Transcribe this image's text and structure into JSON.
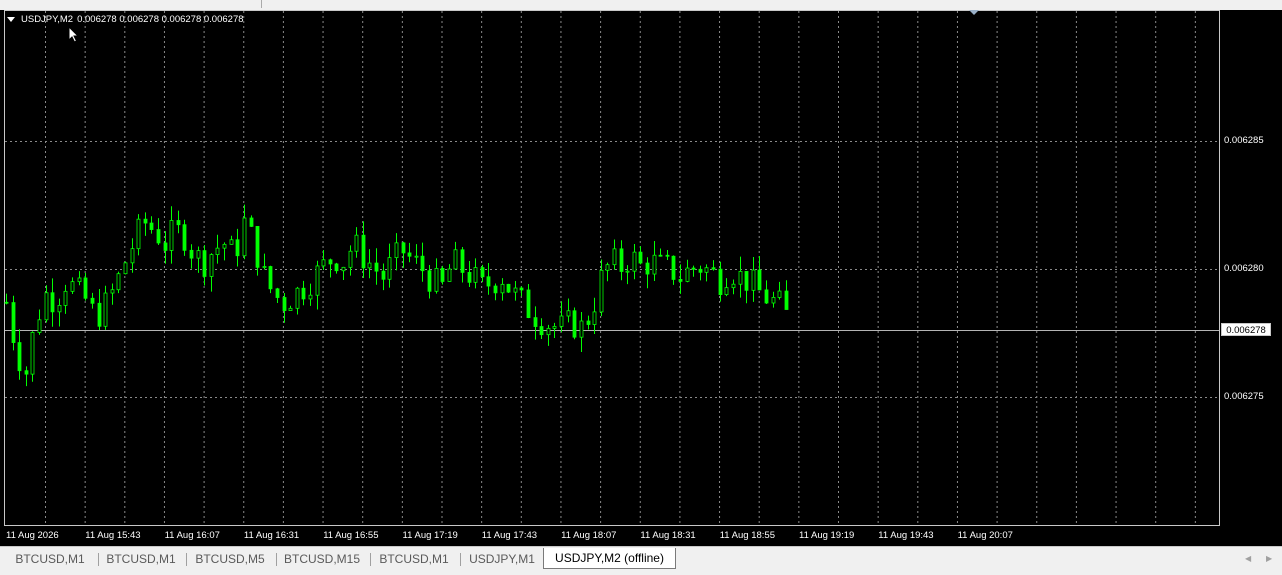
{
  "header": {
    "symbol": "USDJPY,M2",
    "ohlc": "0.006278 0.006278 0.006278 0.006278"
  },
  "price_axis": {
    "labels": [
      "0.006285",
      "0.006280",
      "0.006275"
    ],
    "current_price": "0.006278"
  },
  "time_axis": {
    "labels": [
      "11 Aug 2026",
      "11 Aug 15:43",
      "11 Aug 16:07",
      "11 Aug 16:31",
      "11 Aug 16:55",
      "11 Aug 17:19",
      "11 Aug 17:43",
      "11 Aug 18:07",
      "11 Aug 18:31",
      "11 Aug 18:55",
      "11 Aug 19:19",
      "11 Aug 19:43",
      "11 Aug 20:07"
    ]
  },
  "tabs": {
    "items": [
      "BTCUSD,M1",
      "BTCUSD,M1",
      "BTCUSD,M5",
      "BTCUSD,M15",
      "BTCUSD,M1",
      "USDJPY,M1"
    ],
    "active": "USDJPY,M2 (offline)"
  },
  "icons": {
    "scroll_left": "chevron-left-icon",
    "scroll_right": "chevron-right-icon",
    "cursor": "mouse-pointer-icon"
  },
  "colors": {
    "background": "#000000",
    "grid": "#8a8a8a",
    "candle": "#00ff00",
    "foreground": "#ffffff",
    "current_price_line": "#b4b4b4"
  },
  "chart_data": {
    "type": "candlestick",
    "symbol": "USDJPY",
    "timeframe": "M2",
    "y_range": [
      0.00627,
      0.00629
    ],
    "grid": true,
    "current_price": 0.006278,
    "series_close_path": [
      [
        0,
        0.0062787
      ],
      [
        3,
        0.0062768
      ],
      [
        6,
        0.006276
      ],
      [
        9,
        0.006278
      ],
      [
        12,
        0.006279
      ],
      [
        15,
        0.0062788
      ],
      [
        18,
        0.0062795
      ],
      [
        21,
        0.0062792
      ],
      [
        24,
        0.0062788
      ],
      [
        27,
        0.0062781
      ],
      [
        30,
        0.0062786
      ],
      [
        33,
        0.0062793
      ],
      [
        36,
        0.0062803
      ],
      [
        39,
        0.0062812
      ],
      [
        42,
        0.0062818
      ],
      [
        45,
        0.0062815
      ],
      [
        48,
        0.006281
      ],
      [
        51,
        0.0062815
      ],
      [
        54,
        0.0062813
      ],
      [
        57,
        0.0062805
      ],
      [
        60,
        0.0062803
      ],
      [
        63,
        0.0062808
      ],
      [
        66,
        0.006281
      ],
      [
        69,
        0.0062805
      ],
      [
        72,
        0.0062818
      ],
      [
        75,
        0.006281
      ],
      [
        78,
        0.0062797
      ],
      [
        81,
        0.006279
      ],
      [
        84,
        0.0062787
      ],
      [
        87,
        0.006279
      ],
      [
        90,
        0.0062793
      ],
      [
        93,
        0.0062797
      ],
      [
        96,
        0.0062801
      ],
      [
        99,
        0.0062805
      ],
      [
        102,
        0.0062803
      ],
      [
        105,
        0.006281
      ],
      [
        108,
        0.0062805
      ],
      [
        111,
        0.0062801
      ],
      [
        114,
        0.0062797
      ],
      [
        117,
        0.0062803
      ],
      [
        120,
        0.0062807
      ],
      [
        123,
        0.0062803
      ],
      [
        126,
        0.00628
      ],
      [
        129,
        0.0062795
      ],
      [
        132,
        0.0062793
      ],
      [
        135,
        0.0062803
      ],
      [
        138,
        0.00628
      ],
      [
        141,
        0.0062797
      ],
      [
        144,
        0.0062793
      ],
      [
        147,
        0.0062795
      ],
      [
        150,
        0.0062797
      ],
      [
        153,
        0.0062791
      ],
      [
        156,
        0.0062787
      ],
      [
        159,
        0.0062783
      ],
      [
        162,
        0.006278
      ],
      [
        165,
        0.0062778
      ],
      [
        168,
        0.0062777
      ],
      [
        171,
        0.0062779
      ],
      [
        174,
        0.0062777
      ],
      [
        177,
        0.0062783
      ],
      [
        180,
        0.0062796
      ],
      [
        183,
        0.0062803
      ],
      [
        186,
        0.0062801
      ],
      [
        189,
        0.0062805
      ],
      [
        192,
        0.0062801
      ],
      [
        195,
        0.0062803
      ],
      [
        198,
        0.0062801
      ],
      [
        201,
        0.00628
      ],
      [
        204,
        0.0062797
      ],
      [
        207,
        0.00628
      ],
      [
        210,
        0.0062801
      ],
      [
        213,
        0.0062799
      ],
      [
        216,
        0.0062796
      ],
      [
        219,
        0.00628
      ],
      [
        222,
        0.0062797
      ],
      [
        225,
        0.0062795
      ],
      [
        228,
        0.0062791
      ],
      [
        231,
        0.0062788
      ],
      [
        234,
        0.0062786
      ],
      [
        237,
        0.006278
      ]
    ],
    "x_unit": "minutes since 11 Aug 2026 15:19"
  }
}
